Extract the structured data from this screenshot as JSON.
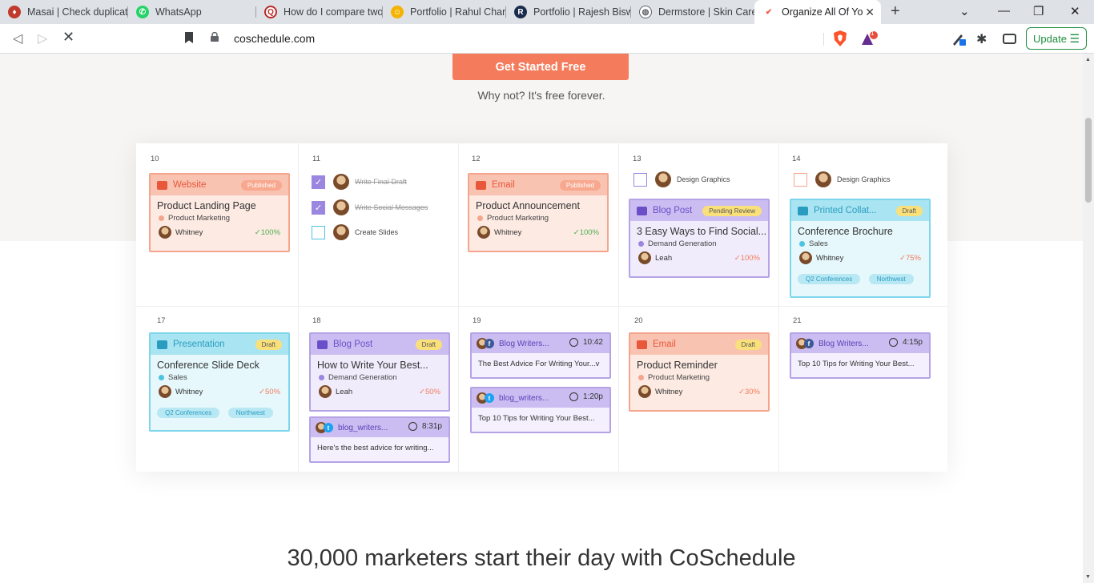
{
  "browser": {
    "tabs": [
      {
        "title": "Masai | Check duplicat",
        "icon": "masai-icon",
        "color": "#c0392b"
      },
      {
        "title": "WhatsApp",
        "icon": "whatsapp-icon",
        "color": "#25d366"
      },
      {
        "title": "How do I compare two",
        "icon": "quora-icon",
        "color": "#b92b27"
      },
      {
        "title": "Portfolio | Rahul Chanc",
        "icon": "portfolio-icon",
        "color": "#f5b301"
      },
      {
        "title": "Portfolio | Rajesh Biswa",
        "icon": "portfolio-r-icon",
        "color": "#1a2b4c"
      },
      {
        "title": "Dermstore | Skin Care",
        "icon": "globe-icon",
        "color": "#5f6368"
      },
      {
        "title": "Organize All Of Yo",
        "icon": "coschedule-icon",
        "color": "#f15a4a"
      }
    ],
    "url": "coschedule.com",
    "update_label": "Update",
    "notification_count": "1"
  },
  "hero": {
    "cta_label": "Get Started Free",
    "cta_sub": "Why not? It's free forever."
  },
  "calendar": {
    "days": [
      "10",
      "11",
      "12",
      "13",
      "14",
      "17",
      "18",
      "19",
      "20",
      "21"
    ],
    "tasks_11": [
      {
        "label": "Write Final Draft",
        "done": true
      },
      {
        "label": "Write Social Messages",
        "done": true
      },
      {
        "label": "Create Slides",
        "done": false
      }
    ],
    "tasks_13": {
      "label": "Design Graphics"
    },
    "tasks_14": {
      "label": "Design Graphics"
    },
    "cards": {
      "website": {
        "type": "Website",
        "badge": "Published",
        "title": "Product Landing Page",
        "tag": "Product Marketing",
        "person": "Whitney",
        "pct": "✓100%"
      },
      "email1": {
        "type": "Email",
        "badge": "Published",
        "title": "Product Announcement",
        "tag": "Product Marketing",
        "person": "Whitney",
        "pct": "✓100%"
      },
      "blog1": {
        "type": "Blog Post",
        "badge": "Pending Review",
        "title": "3 Easy Ways to Find Social...",
        "tag": "Demand Generation",
        "person": "Leah",
        "pct": "✓100%"
      },
      "printed": {
        "type": "Printed Collat...",
        "badge": "Draft",
        "title": "Conference Brochure",
        "tag": "Sales",
        "person": "Whitney",
        "pct": "✓75%",
        "pills": [
          "Q2 Conferences",
          "Northwest"
        ]
      },
      "presentation": {
        "type": "Presentation",
        "badge": "Draft",
        "title": "Conference Slide Deck",
        "tag": "Sales",
        "person": "Whitney",
        "pct": "✓50%",
        "pills": [
          "Q2 Conferences",
          "Northwest"
        ]
      },
      "blog2": {
        "type": "Blog Post",
        "badge": "Draft",
        "title": "How to Write Your Best...",
        "tag": "Demand Generation",
        "person": "Leah",
        "pct": "✓50%"
      },
      "email2": {
        "type": "Email",
        "badge": "Draft",
        "title": "Product Reminder",
        "tag": "Product Marketing",
        "person": "Whitney",
        "pct": "✓30%"
      }
    },
    "social": {
      "s18": {
        "account": "blog_writers...",
        "time": "8:31p",
        "text": "Here's the best advice for writing..."
      },
      "s19a": {
        "account": "Blog Writers...",
        "time": "10:42",
        "text": "The Best Advice For Writing Your...v"
      },
      "s19b": {
        "account": "blog_writers...",
        "time": "1:20p",
        "text": "Top 10 Tips for Writing Your Best..."
      },
      "s21": {
        "account": "Blog Writers...",
        "time": "4:15p",
        "text": "Top 10 Tips for Writing Your Best..."
      }
    }
  },
  "headline": "30,000 marketers start their day with CoSchedule",
  "colors": {
    "orange": "#f47c5c",
    "purple": "#9b86e0",
    "teal": "#4cc3e0"
  }
}
